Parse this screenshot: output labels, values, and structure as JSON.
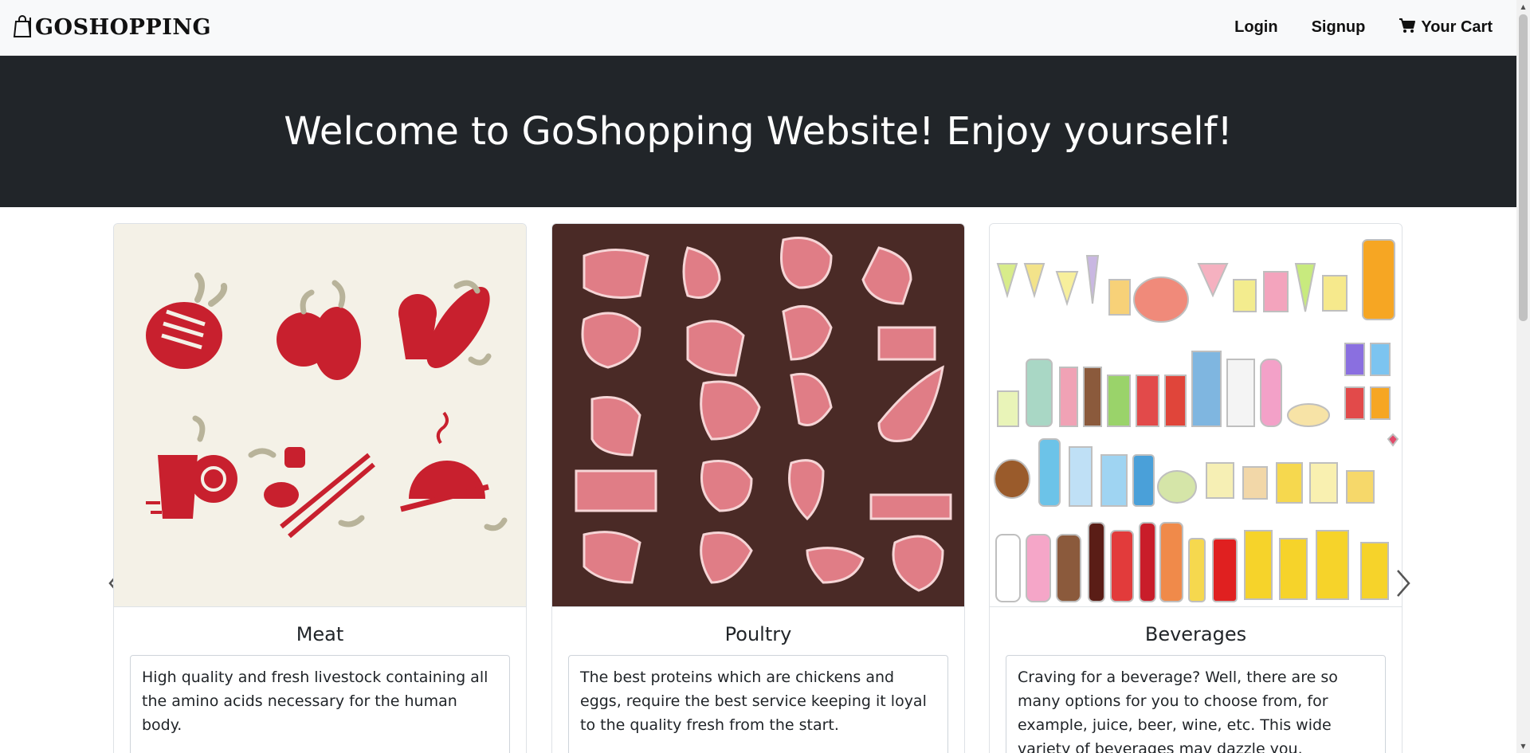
{
  "navbar": {
    "brand": "GOSHOPPING",
    "links": [
      {
        "label": "Login"
      },
      {
        "label": "Signup"
      },
      {
        "label": "Your Cart"
      }
    ]
  },
  "hero": {
    "title": "Welcome to GoShopping Website! Enjoy yourself!"
  },
  "carousel": {
    "cards": [
      {
        "title": "Meat",
        "description": "High quality and fresh livestock containing all the amino acids necessary for the human body."
      },
      {
        "title": "Poultry",
        "description": "The best proteins which are chickens and eggs, require the best service keeping it loyal to the quality fresh from the start."
      },
      {
        "title": "Beverages",
        "description": "Craving for a beverage? Well, there are so many options for you to choose from, for example, juice, beer, wine, etc. This wide variety of beverages may dazzle you."
      }
    ]
  },
  "colors": {
    "navbar_bg": "#f8f9fa",
    "hero_bg": "#212529",
    "accent_red": "#c8202e"
  }
}
